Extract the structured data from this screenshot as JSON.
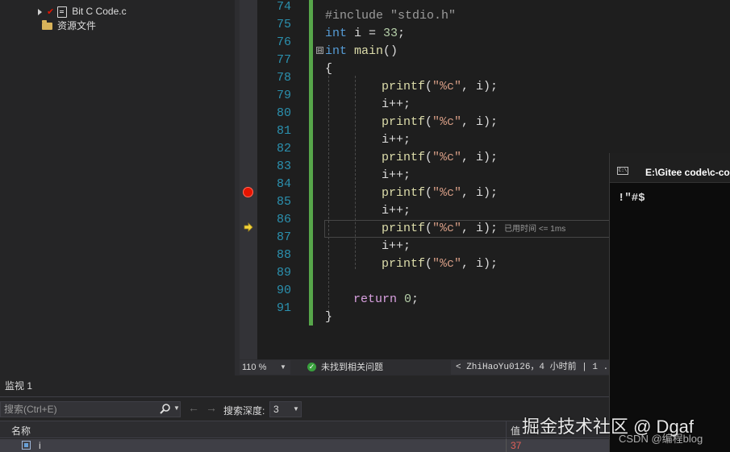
{
  "solution_explorer": {
    "items": [
      {
        "label": "Bit C Code.c"
      },
      {
        "label": "资源文件"
      }
    ]
  },
  "editor": {
    "line_numbers": [
      "74",
      "75",
      "76",
      "77",
      "78",
      "79",
      "80",
      "81",
      "82",
      "83",
      "84",
      "85",
      "86",
      "87",
      "88",
      "89",
      "90",
      "91"
    ],
    "fold_marker": "⊟",
    "lines": {
      "l74": {
        "text": "#include \"stdio.h\""
      },
      "l75": {
        "kw": "int",
        "rest": " i = ",
        "num": "33",
        "end": ";"
      },
      "l76": {
        "kw": "int",
        "sp": " ",
        "fn": "main",
        "end": "()"
      },
      "l77": {
        "text": "{"
      },
      "printf_fn": "printf",
      "printf_open": "(",
      "printf_str": "\"%c\"",
      "printf_args": ", i);",
      "incr": "i++;",
      "l90": {
        "kw": "return",
        "sp": " ",
        "num": "0",
        "end": ";"
      },
      "l91": {
        "text": "}"
      }
    },
    "elapsed_hint": "已用时间 <= 1ms",
    "breakpoint_line": "84",
    "current_line": "86"
  },
  "status_bar": {
    "zoom": "110 %",
    "issues_text": "未找到相关问题",
    "git_text": "< ZhiHaoYu0126，4 小时前 | 1 ..."
  },
  "watch": {
    "title": "监视 1",
    "search_placeholder": "搜索(Ctrl+E)",
    "depth_label": "搜索深度:",
    "depth_value": "3",
    "col_name": "名称",
    "col_value": "值",
    "rows": [
      {
        "name": "i",
        "value": "37"
      }
    ]
  },
  "console": {
    "title": "E:\\Gitee code\\c-cou",
    "icon_text": "C:\\",
    "output": "!\"#$"
  },
  "watermark": {
    "main": "掘金技术社区 @ Dgaf",
    "sub": "CSDN @编程blog"
  },
  "colors": {
    "keyword": "#569cd6",
    "function": "#dcdcaa",
    "string": "#d69d85",
    "number": "#b5cea8",
    "line_number": "#2b91af",
    "breakpoint": "#e51400",
    "changed_bar": "#57a64a"
  }
}
